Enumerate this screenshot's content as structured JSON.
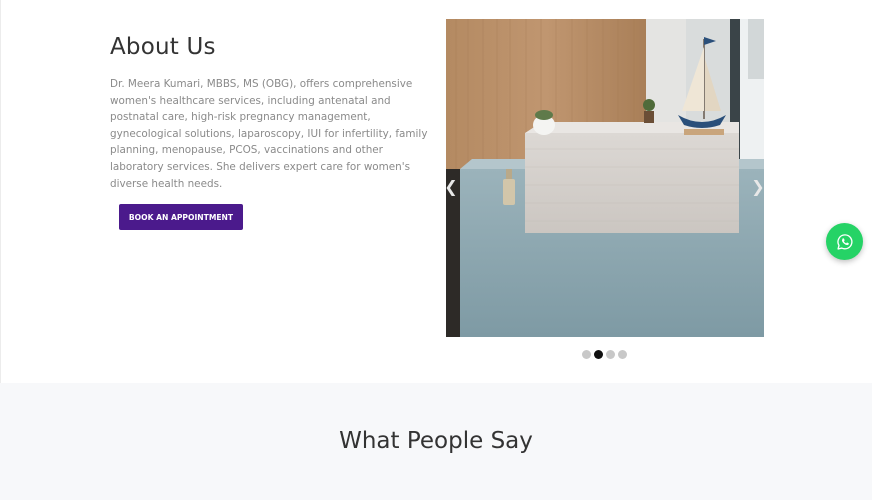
{
  "about": {
    "title": "About Us",
    "body": "Dr. Meera Kumari, MBBS, MS (OBG), offers comprehensive women's healthcare services, including antenatal and postnatal care, high-risk pregnancy management, gynecological solutions, laparoscopy, IUI for infertility, family planning, menopause, PCOS, vaccinations and other laboratory services. She delivers expert care for women's diverse health needs.",
    "cta_label": "BOOK AN APPOINTMENT"
  },
  "carousel": {
    "prev_glyph": "❮",
    "next_glyph": "❯",
    "slide_count": 4,
    "active_index": 1
  },
  "testimonials": {
    "title": "What People Say"
  },
  "colors": {
    "accent": "#4b1a8c",
    "whatsapp": "#25d366",
    "dot_active": "#111111",
    "dot_inactive": "#c8c8c8"
  },
  "icons": {
    "floating_action": "whatsapp-icon"
  }
}
